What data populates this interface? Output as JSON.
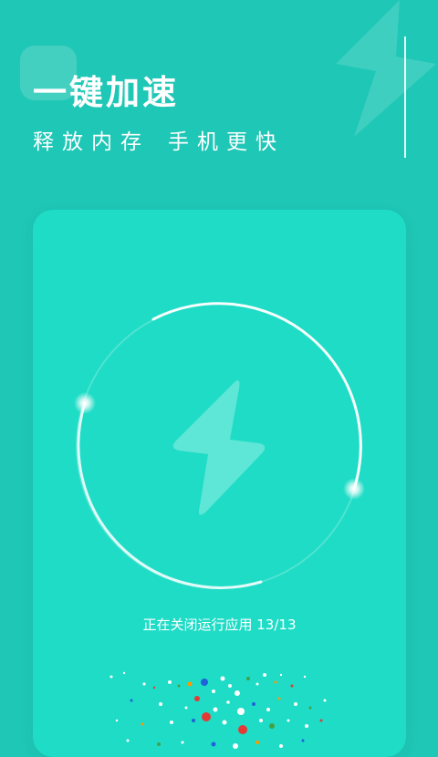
{
  "header": {
    "title": "一键加速",
    "subtitle_part1": "释放内存",
    "subtitle_part2": "手机更快"
  },
  "boost_card": {
    "status_prefix": "正在关闭运行应用",
    "closed_count": "13",
    "total_count": "13",
    "status_text": "正在关闭运行应用 13/13",
    "center_icon": "lightning-bolt-icon"
  },
  "colors": {
    "background": "#1fc7b6",
    "card": "#1edcc6",
    "bolt": "#5ee6d6",
    "ring": "#ffffff"
  }
}
